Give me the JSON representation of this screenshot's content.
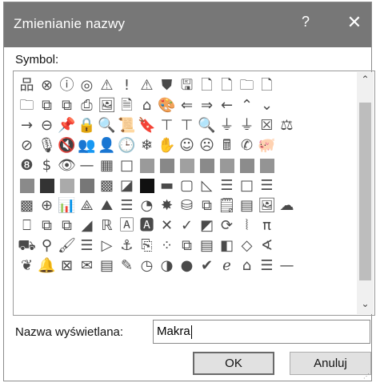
{
  "dialog": {
    "title": "Zmienianie nazwy",
    "help_label": "?",
    "close_label": "✕"
  },
  "symbol_label": "Symbol:",
  "display_name_label": "Nazwa wyświetlana:",
  "display_name_value": "Makra",
  "ok_label": "OK",
  "cancel_label": "Anuluj",
  "scroll": {
    "up": "⌃",
    "down": "⌄"
  },
  "icons": [
    {
      "g": "品",
      "n": "org-chart-icon"
    },
    {
      "g": "⊗",
      "n": "cancel-circle-icon"
    },
    {
      "g": "ⓘ",
      "n": "info-icon"
    },
    {
      "g": "◎",
      "n": "target-icon"
    },
    {
      "g": "⚠",
      "n": "warning-icon"
    },
    {
      "g": "!",
      "n": "exclamation-icon"
    },
    {
      "g": "⚠",
      "n": "warning-outline-icon"
    },
    {
      "g": "⛊",
      "n": "shield-icon"
    },
    {
      "g": "🖫",
      "n": "save-icon"
    },
    {
      "g": "🗋",
      "n": "page-arrow-icon"
    },
    {
      "g": "🗋",
      "n": "page-refresh-icon"
    },
    {
      "g": "🗀",
      "n": "folder-icon"
    },
    {
      "g": "🗋",
      "n": "blank-page-icon"
    },
    {
      "g": "",
      "n": "empty-slot"
    },
    {
      "g": "",
      "n": "empty-slot"
    },
    {
      "g": "",
      "n": "empty-slot"
    },
    {
      "g": "🗀",
      "n": "open-folder-icon"
    },
    {
      "g": "⧉",
      "n": "copy-icon"
    },
    {
      "g": "⧉",
      "n": "paste-icon"
    },
    {
      "g": "⎙",
      "n": "print-icon"
    },
    {
      "g": "🖼",
      "n": "picture-icon"
    },
    {
      "g": "🗎",
      "n": "document-icon"
    },
    {
      "g": "⌂",
      "n": "home-icon"
    },
    {
      "g": "🎨",
      "n": "palette-icon"
    },
    {
      "g": "⇐",
      "n": "back-icon"
    },
    {
      "g": "⇒",
      "n": "forward-icon"
    },
    {
      "g": "←",
      "n": "left-arrow-icon"
    },
    {
      "g": "⌃",
      "n": "up-chevron-icon"
    },
    {
      "g": "⌄",
      "n": "down-chevron-icon"
    },
    {
      "g": "",
      "n": "empty-slot"
    },
    {
      "g": "",
      "n": "empty-slot"
    },
    {
      "g": "",
      "n": "empty-slot"
    },
    {
      "g": "→",
      "n": "right-arrow-icon"
    },
    {
      "g": "⊖",
      "n": "back-circle-icon"
    },
    {
      "g": "📌",
      "n": "pin-icon"
    },
    {
      "g": "🔒",
      "n": "lock-icon"
    },
    {
      "g": "🔍",
      "n": "key-icon"
    },
    {
      "g": "📜",
      "n": "scroll-icon"
    },
    {
      "g": "🔖",
      "n": "bookmark-icon"
    },
    {
      "g": "⊤",
      "n": "podium-icon"
    },
    {
      "g": "⊤",
      "n": "presenter-icon"
    },
    {
      "g": "🔍",
      "n": "search-icon"
    },
    {
      "g": "⏚",
      "n": "filter-icon"
    },
    {
      "g": "⏚",
      "n": "filter-clear-icon"
    },
    {
      "g": "☒",
      "n": "id-card-icon"
    },
    {
      "g": "⚖",
      "n": "scales-icon"
    },
    {
      "g": "",
      "n": "empty-slot"
    },
    {
      "g": "",
      "n": "empty-slot"
    },
    {
      "g": "⊘",
      "n": "no-entry-icon"
    },
    {
      "g": "🎙",
      "n": "microphone-icon"
    },
    {
      "g": "🔇",
      "n": "mute-icon"
    },
    {
      "g": "👥",
      "n": "users-icon"
    },
    {
      "g": "👤",
      "n": "user-icon"
    },
    {
      "g": "🕒",
      "n": "clock-icon"
    },
    {
      "g": "❄",
      "n": "snowflake-icon"
    },
    {
      "g": "✋",
      "n": "hand-icon"
    },
    {
      "g": "☺",
      "n": "smile-icon"
    },
    {
      "g": "☹",
      "n": "frown-icon"
    },
    {
      "g": "🖩",
      "n": "calculator-icon"
    },
    {
      "g": "✆",
      "n": "phone-icon"
    },
    {
      "g": "🐖",
      "n": "piggy-bank-icon"
    },
    {
      "g": "",
      "n": "empty-slot"
    },
    {
      "g": "",
      "n": "empty-slot"
    },
    {
      "g": "",
      "n": "empty-slot"
    },
    {
      "g": "❽",
      "n": "eight-ball-icon"
    },
    {
      "g": "$",
      "n": "dollar-icon"
    },
    {
      "g": "👁",
      "n": "eye-icon"
    },
    {
      "g": "—",
      "n": "dash-icon"
    },
    {
      "g": "▦",
      "n": "grid-icon"
    },
    {
      "g": "□",
      "n": "swatch-white"
    },
    {
      "g": "",
      "n": "swatch-gray-1",
      "c": "#9a9a9a"
    },
    {
      "g": "",
      "n": "swatch-gray-2",
      "c": "#888"
    },
    {
      "g": "",
      "n": "swatch-gray-3",
      "c": "#a0a0a0"
    },
    {
      "g": "",
      "n": "swatch-gray-4",
      "c": "#8a8a8a"
    },
    {
      "g": "",
      "n": "swatch-gray-5",
      "c": "#999"
    },
    {
      "g": "",
      "n": "swatch-gray-6",
      "c": "#8c8c8c"
    },
    {
      "g": "",
      "n": "swatch-gray-7",
      "c": "#949494"
    },
    {
      "g": "",
      "n": "empty-slot"
    },
    {
      "g": "",
      "n": "empty-slot"
    },
    {
      "g": "",
      "n": "empty-slot"
    },
    {
      "g": "",
      "n": "swatch-gray-8",
      "c": "#8a8a8a"
    },
    {
      "g": "",
      "n": "swatch-dark-1",
      "c": "#333"
    },
    {
      "g": "",
      "n": "swatch-gray-9",
      "c": "#aaa"
    },
    {
      "g": "",
      "n": "swatch-gray-10",
      "c": "#777"
    },
    {
      "g": "▩",
      "n": "swatch-pattern"
    },
    {
      "g": "◪",
      "n": "swatch-diagonal"
    },
    {
      "g": "",
      "n": "swatch-black",
      "c": "#111"
    },
    {
      "g": "▬",
      "n": "swatch-bars"
    },
    {
      "g": "▢",
      "n": "swatch-bold-box"
    },
    {
      "g": "◺",
      "n": "swatch-slash"
    },
    {
      "g": "☰",
      "n": "swatch-stripes"
    },
    {
      "g": "□",
      "n": "swatch-white-2"
    },
    {
      "g": "☰",
      "n": "swatch-bands"
    },
    {
      "g": "",
      "n": "empty-slot"
    },
    {
      "g": "",
      "n": "empty-slot"
    },
    {
      "g": "",
      "n": "empty-slot"
    },
    {
      "g": "▩",
      "n": "checker-icon"
    },
    {
      "g": "⊕",
      "n": "arrow-circle-icon"
    },
    {
      "g": "📊",
      "n": "bar-chart-icon"
    },
    {
      "g": "⟁",
      "n": "triangle-icon"
    },
    {
      "g": "⛰",
      "n": "mountain-icon"
    },
    {
      "g": "☰",
      "n": "align-icon"
    },
    {
      "g": "◔",
      "n": "pie-chart-icon"
    },
    {
      "g": "✸",
      "n": "radar-icon"
    },
    {
      "g": "⛁",
      "n": "database-icon"
    },
    {
      "g": "⧉",
      "n": "shapes-icon"
    },
    {
      "g": "🗒",
      "n": "note-icon"
    },
    {
      "g": "▤",
      "n": "list-icon"
    },
    {
      "g": "🖼",
      "n": "image-edit-icon"
    },
    {
      "g": "☁",
      "n": "landscape-icon"
    },
    {
      "g": "",
      "n": "empty-slot"
    },
    {
      "g": "",
      "n": "empty-slot"
    },
    {
      "g": "⎕",
      "n": "frame-icon"
    },
    {
      "g": "⧉",
      "n": "select-icon"
    },
    {
      "g": "⧉",
      "n": "group-icon"
    },
    {
      "g": "◢",
      "n": "diagonal-icon"
    },
    {
      "g": "ℝ",
      "n": "text-format-icon"
    },
    {
      "g": "🄰",
      "n": "letter-a-box-icon"
    },
    {
      "g": "🅰",
      "n": "letter-a-filled-icon"
    },
    {
      "g": "✕",
      "n": "x-icon"
    },
    {
      "g": "✓",
      "n": "check-icon"
    },
    {
      "g": "◩",
      "n": "pen-box-icon"
    },
    {
      "g": "⟳",
      "n": "refresh-icon"
    },
    {
      "g": "⦚",
      "n": "bracket-icon"
    },
    {
      "g": "π",
      "n": "pi-icon"
    },
    {
      "g": "",
      "n": "empty-slot"
    },
    {
      "g": "",
      "n": "empty-slot"
    },
    {
      "g": "",
      "n": "empty-slot"
    },
    {
      "g": "⛟",
      "n": "fill-bucket-icon"
    },
    {
      "g": "⚲",
      "n": "magnifier-icon"
    },
    {
      "g": "🖌",
      "n": "brush-icon"
    },
    {
      "g": "☰",
      "n": "bullet-list-icon"
    },
    {
      "g": "▷",
      "n": "play-icon"
    },
    {
      "g": "⚓",
      "n": "anchor-icon"
    },
    {
      "g": "⎘",
      "n": "print-preview-icon"
    },
    {
      "g": "⁘",
      "n": "lasso-icon"
    },
    {
      "g": "⧉",
      "n": "duplicate-icon"
    },
    {
      "g": "▤",
      "n": "table-icon"
    },
    {
      "g": "◧",
      "n": "form-icon"
    },
    {
      "g": "◇",
      "n": "eraser-icon"
    },
    {
      "g": "∢",
      "n": "angle-icon"
    },
    {
      "g": "",
      "n": "empty-slot"
    },
    {
      "g": "",
      "n": "empty-slot"
    },
    {
      "g": "",
      "n": "empty-slot"
    },
    {
      "g": "❦",
      "n": "butterfly-icon"
    },
    {
      "g": "🔔",
      "n": "bell-icon"
    },
    {
      "g": "⊠",
      "n": "envelope-open-icon"
    },
    {
      "g": "✉",
      "n": "envelope-icon"
    },
    {
      "g": "▤",
      "n": "contact-card-icon"
    },
    {
      "g": "✎",
      "n": "edit-form-icon"
    },
    {
      "g": "◷",
      "n": "timer-icon"
    },
    {
      "g": "◑",
      "n": "disc-icon"
    },
    {
      "g": "●",
      "n": "record-icon"
    },
    {
      "g": "✔",
      "n": "checked-circle-icon"
    },
    {
      "g": "ℯ",
      "n": "browser-icon"
    },
    {
      "g": "⌂",
      "n": "home-2-icon"
    },
    {
      "g": "☰",
      "n": "menu-icon"
    },
    {
      "g": "—",
      "n": "minus-icon"
    },
    {
      "g": "",
      "n": "empty-slot"
    },
    {
      "g": "",
      "n": "empty-slot"
    }
  ]
}
